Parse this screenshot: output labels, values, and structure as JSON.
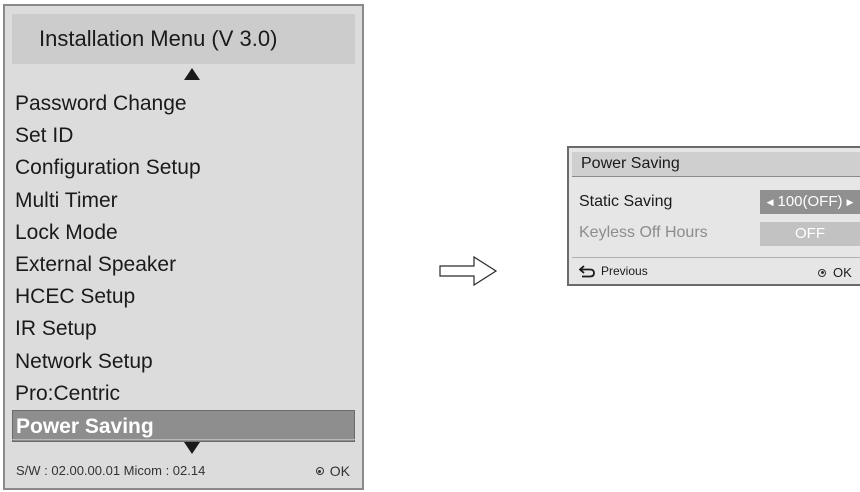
{
  "menu": {
    "title": "Installation Menu (V 3.0)",
    "items": [
      {
        "label": "Password Change"
      },
      {
        "label": "Set ID"
      },
      {
        "label": "Configuration Setup"
      },
      {
        "label": "Multi Timer"
      },
      {
        "label": "Lock Mode"
      },
      {
        "label": "External Speaker"
      },
      {
        "label": "HCEC Setup"
      },
      {
        "label": "IR Setup"
      },
      {
        "label": "Network Setup"
      },
      {
        "label": "Pro:Centric"
      },
      {
        "label": "Power Saving",
        "selected": true
      }
    ],
    "version": "S/W : 02.00.00.01 Micom : 02.14",
    "ok_label": "OK"
  },
  "panel": {
    "title": "Power Saving",
    "rows": [
      {
        "label": "Static Saving",
        "value": "100(OFF)",
        "enabled": true
      },
      {
        "label": "Keyless Off Hours",
        "value": "OFF",
        "enabled": false
      }
    ],
    "previous_label": "Previous",
    "ok_label": "OK"
  },
  "icons": {
    "up": "arrow-up-icon",
    "down": "arrow-down-icon",
    "ok": "ok-dot-icon",
    "back": "back-arrow-icon",
    "transition": "right-arrow-icon"
  },
  "colors": {
    "menu_bg": "#dcdcdc",
    "selected_bg": "#8e8e8e",
    "value_active_bg": "#909090",
    "value_dim_bg": "#c2c2c2"
  }
}
